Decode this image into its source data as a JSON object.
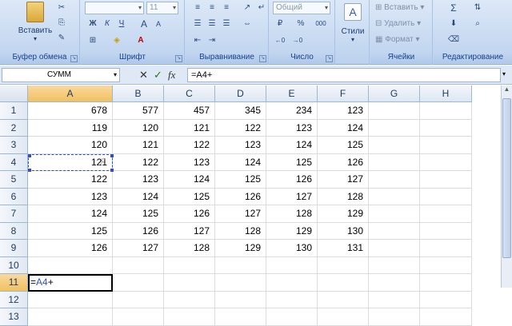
{
  "ribbon": {
    "clipboard": {
      "paste_label": "Вставить",
      "group_label": "Буфер обмена"
    },
    "font": {
      "size_value": "11",
      "bold": "Ж",
      "italic": "К",
      "underline": "Ч",
      "grow": "A",
      "shrink": "A",
      "group_label": "Шрифт"
    },
    "alignment": {
      "group_label": "Выравнивание"
    },
    "number": {
      "format_value": "Общий",
      "percent": "%",
      "thousands": "000",
      "group_label": "Число"
    },
    "styles": {
      "label": "Стили"
    },
    "cells": {
      "insert_label": "Вставить",
      "delete_label": "Удалить",
      "format_label": "Формат",
      "group_label": "Ячейки"
    },
    "editing": {
      "sum": "Σ",
      "group_label": "Редактирование"
    }
  },
  "formula_bar": {
    "name_box": "СУММ",
    "cancel": "✕",
    "enter": "✓",
    "fx": "fx",
    "formula": "=A4+"
  },
  "sheet": {
    "columns": [
      "A",
      "B",
      "C",
      "D",
      "E",
      "F",
      "G",
      "H"
    ],
    "rows": [
      {
        "n": "1",
        "cells": [
          "678",
          "577",
          "457",
          "345",
          "234",
          "123"
        ]
      },
      {
        "n": "2",
        "cells": [
          "119",
          "120",
          "121",
          "122",
          "123",
          "124"
        ]
      },
      {
        "n": "3",
        "cells": [
          "120",
          "121",
          "122",
          "123",
          "124",
          "125"
        ]
      },
      {
        "n": "4",
        "cells": [
          "121",
          "122",
          "123",
          "124",
          "125",
          "126"
        ]
      },
      {
        "n": "5",
        "cells": [
          "122",
          "123",
          "124",
          "125",
          "126",
          "127"
        ]
      },
      {
        "n": "6",
        "cells": [
          "123",
          "124",
          "125",
          "126",
          "127",
          "128"
        ]
      },
      {
        "n": "7",
        "cells": [
          "124",
          "125",
          "126",
          "127",
          "128",
          "129"
        ]
      },
      {
        "n": "8",
        "cells": [
          "125",
          "126",
          "127",
          "128",
          "129",
          "130"
        ]
      },
      {
        "n": "9",
        "cells": [
          "126",
          "127",
          "128",
          "129",
          "130",
          "131"
        ]
      },
      {
        "n": "10",
        "cells": [
          "",
          "",
          "",
          "",
          "",
          ""
        ]
      },
      {
        "n": "11",
        "cells": [
          "",
          "",
          "",
          "",
          "",
          ""
        ]
      },
      {
        "n": "12",
        "cells": [
          "",
          "",
          "",
          "",
          "",
          ""
        ]
      },
      {
        "n": "13",
        "cells": [
          "",
          "",
          "",
          "",
          "",
          ""
        ]
      }
    ],
    "active_cell_text": "=A4+",
    "reference_cell": "A4"
  },
  "colors": {
    "ribbon_bg": "#c9dbf2",
    "group_label": "#15428b",
    "reference_blue": "#2f4fc4",
    "header_selected": "#f1c15f"
  }
}
